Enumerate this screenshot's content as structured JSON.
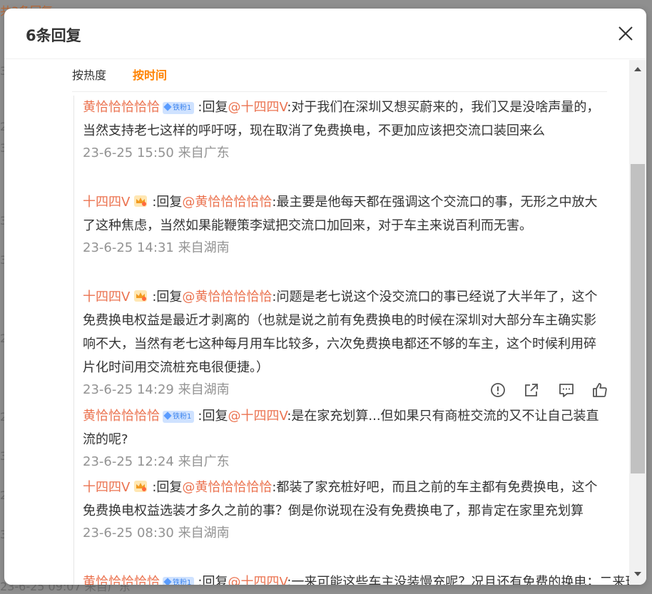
{
  "background": {
    "lines": [
      "共3条回复",
      "",
      "3",
      "3",
      "2",
      "2",
      "",
      "3",
      "2",
      "3",
      "2",
      "3",
      "3",
      "23-6-25 09:07 来自广东"
    ]
  },
  "dialog": {
    "title": "6条回复",
    "tabs": [
      {
        "label": "按热度",
        "active": false
      },
      {
        "label": "按时间",
        "active": true
      }
    ]
  },
  "reply_prefix": ":回复",
  "comments": [
    {
      "user": "黄恰恰恰恰恰",
      "badge": "铁粉1",
      "badge_type": "fan",
      "reply_to": "@十四四V",
      "text": ":对于我们在深圳又想买蔚来的，我们又是没啥声量的，当然支持老七这样的呼吁呀，现在取消了免费换电，不更加应该把交流口装回来么",
      "time": "23-6-25 15:50",
      "source": "来自广东"
    },
    {
      "user": "十四四V",
      "badge": "",
      "badge_type": "crown",
      "reply_to": "@黄恰恰恰恰恰",
      "text": ":最主要是他每天都在强调这个交流口的事，无形之中放大了这种焦虑，当然如果能鞭策李斌把交流口加回来，对于车主来说百利而无害。",
      "time": "23-6-25 14:31",
      "source": "来自湖南"
    },
    {
      "user": "十四四V",
      "badge": "",
      "badge_type": "crown",
      "reply_to": "@黄恰恰恰恰恰",
      "text": ":问题是老七说这个没交流口的事已经说了大半年了，这个免费换电权益是最近才剥离的（也就是说之前有免费换电的时候在深圳对大部分车主确实影响不大，当然有老七这种每月用车比较多，六次免费换电都还不够的车主，这个时候利用碎片化时间用交流桩充电很便捷。）",
      "time": "23-6-25 14:29",
      "source": "来自湖南"
    },
    {
      "user": "黄恰恰恰恰恰",
      "badge": "铁粉1",
      "badge_type": "fan",
      "reply_to": "@十四四V",
      "text": ":是在家充划算...但如果只有商桩交流的又不让自己装直流的呢?",
      "time": "23-6-25 12:24",
      "source": "来自广东"
    },
    {
      "user": "十四四V",
      "badge": "",
      "badge_type": "crown",
      "reply_to": "@黄恰恰恰恰恰",
      "text": ":都装了家充桩好吧，而且之前的车主都有免费换电，这个免费换电权益选装才多久之前的事？倒是你说现在没有免费换电了，那肯定在家里充划算",
      "time": "23-6-25 08:30",
      "source": "来自湖南"
    },
    {
      "user": "黄恰恰恰恰恰",
      "badge": "铁粉1",
      "badge_type": "fan",
      "reply_to": "@十四四V",
      "text": ":一来可能这些车主没装慢充呢？况且还有免费的换电；二来现",
      "time": "",
      "source": ""
    }
  ],
  "icons": [
    "report-icon",
    "share-icon",
    "comment-icon",
    "like-icon"
  ],
  "colors": {
    "accent": "#ff8200",
    "username": "#eb7350",
    "badge_bg": "#cfe2ff",
    "meta": "#939393"
  }
}
